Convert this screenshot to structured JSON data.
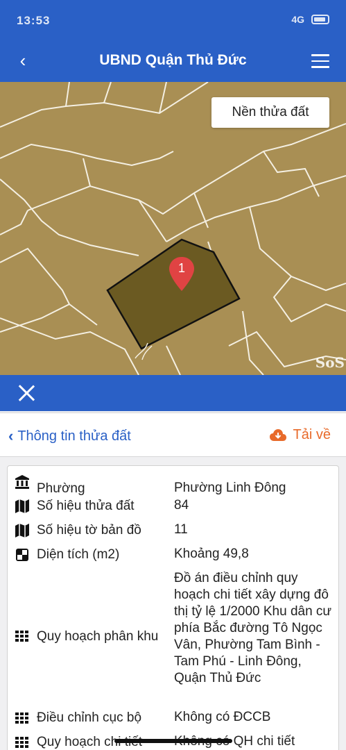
{
  "status": {
    "time": "13:53",
    "signal": "4G",
    "battery_icon": "battery-icon"
  },
  "nav": {
    "back_icon": "chevron-left-icon",
    "title": "UBND Quận Thủ Đức",
    "menu_icon": "hamburger-menu-icon"
  },
  "map": {
    "layer_button": "Nền thửa đất",
    "marker_label": "1",
    "watermark": "SoS"
  },
  "panel": {
    "close_icon": "close-icon",
    "back_label": "Thông tin thửa đất",
    "download_label": "Tải về"
  },
  "parcel": {
    "rows": [
      {
        "icon": "institution-icon",
        "label": "Phường",
        "value": "Phường Linh Đông"
      },
      {
        "icon": "map-icon",
        "label": "Số hiệu thửa đất",
        "value": "84"
      },
      {
        "icon": "map-icon",
        "label": "Số hiệu tờ bản đồ",
        "value": "11"
      },
      {
        "icon": "area-icon",
        "label": "Diện tích (m2)",
        "value": "Khoảng 49,8"
      },
      {
        "icon": "grid-icon",
        "label": "Quy hoạch phân khu",
        "value": "Đồ án điều chỉnh quy hoạch chi tiết xây dựng đô thị tỷ lệ 1/2000 Khu dân cư phía Bắc đường Tô Ngọc Vân, Phường Tam Bình - Tam Phú - Linh Đông, Quận Thủ Đức"
      },
      {
        "icon": "grid-icon",
        "label": "Điều chỉnh cục bộ",
        "value": "Không có ĐCCB"
      },
      {
        "icon": "grid-icon",
        "label": "Quy hoạch chi tiết",
        "value": "Không có QH chi tiết"
      }
    ]
  },
  "colors": {
    "primary": "#2a60c6",
    "map_bg": "#a98f54",
    "parcel_fill": "#6b5a22",
    "accent": "#e86a2a"
  }
}
